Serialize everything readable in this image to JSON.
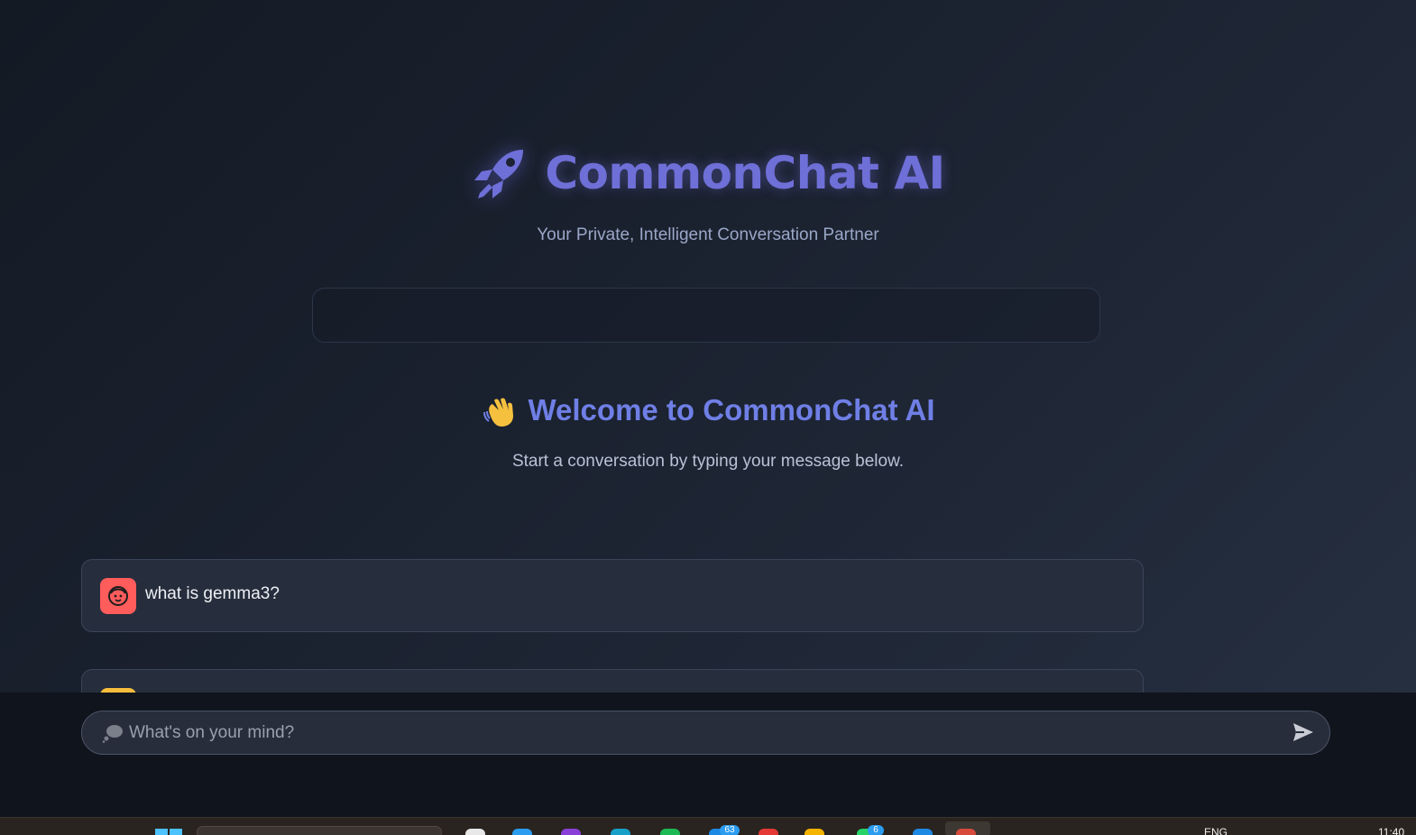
{
  "header": {
    "title": "CommonChat AI",
    "subtitle": "Your Private, Intelligent Conversation Partner",
    "icon": "rocket-icon"
  },
  "welcome": {
    "title": "Welcome to CommonChat AI",
    "subtitle": "Start a conversation by typing your message below.",
    "icon": "waving-hand-icon"
  },
  "messages": [
    {
      "role": "user",
      "text": "what is gemma3?",
      "avatar_color": "#ff5c5c"
    },
    {
      "role": "assistant",
      "text": "",
      "avatar_color": "#f8bd3c"
    }
  ],
  "input": {
    "placeholder": "What's on your mind?",
    "value": "",
    "icon": "thought-bubble-icon",
    "send_icon": "send-icon"
  },
  "taskbar": {
    "badges": [
      "63",
      "6"
    ],
    "language": "ENG",
    "clock": "11:40"
  },
  "colors": {
    "accent": "#6f6fd8",
    "welcome": "#6f7fe6",
    "background": "#1b2230",
    "user_avatar": "#ff5c5c",
    "bot_avatar": "#f8bd3c"
  }
}
